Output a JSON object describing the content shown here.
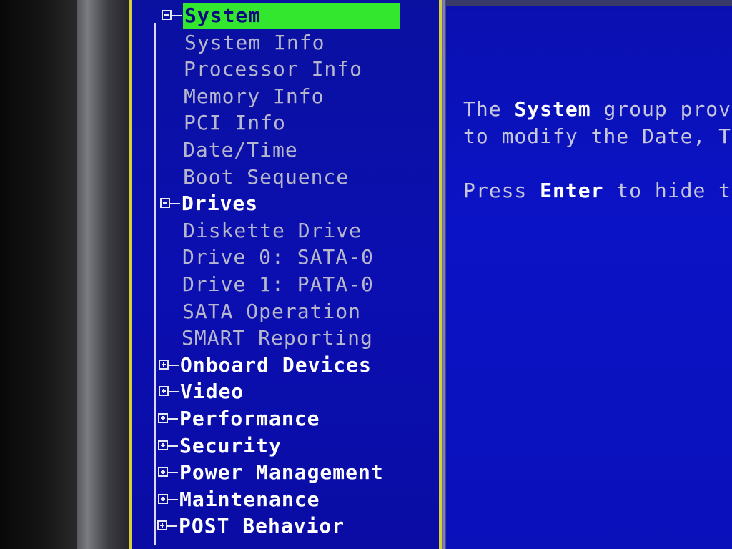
{
  "tree": {
    "selected": "System",
    "items": [
      {
        "label": "System",
        "type": "group",
        "expanded": true
      },
      {
        "label": "System Info",
        "type": "child"
      },
      {
        "label": "Processor Info",
        "type": "child"
      },
      {
        "label": "Memory Info",
        "type": "child"
      },
      {
        "label": "PCI Info",
        "type": "child"
      },
      {
        "label": "Date/Time",
        "type": "child"
      },
      {
        "label": "Boot Sequence",
        "type": "child"
      },
      {
        "label": "Drives",
        "type": "group",
        "expanded": true
      },
      {
        "label": "Diskette Drive",
        "type": "child"
      },
      {
        "label": "Drive 0: SATA-0",
        "type": "child"
      },
      {
        "label": "Drive 1: PATA-0",
        "type": "child"
      },
      {
        "label": "SATA Operation",
        "type": "child"
      },
      {
        "label": "SMART Reporting",
        "type": "child"
      },
      {
        "label": "Onboard Devices",
        "type": "group",
        "expanded": false
      },
      {
        "label": "Video",
        "type": "group",
        "expanded": false
      },
      {
        "label": "Performance",
        "type": "group",
        "expanded": false
      },
      {
        "label": "Security",
        "type": "group",
        "expanded": false
      },
      {
        "label": "Power Management",
        "type": "group",
        "expanded": false
      },
      {
        "label": "Maintenance",
        "type": "group",
        "expanded": false
      },
      {
        "label": "POST Behavior",
        "type": "group",
        "expanded": false
      }
    ]
  },
  "scrollbar": {
    "up_arrow": "↑"
  },
  "help": {
    "line1_pre": "The ",
    "line1_bold": "System",
    "line1_post": " group provi",
    "line2": "to modify the Date, Ti",
    "line3_pre": "Press ",
    "line3_bold": "Enter",
    "line3_post": " to hide th"
  },
  "colors": {
    "background": "#0b0fb0",
    "selection": "#33e62e",
    "frame": "#d4cf3a"
  }
}
